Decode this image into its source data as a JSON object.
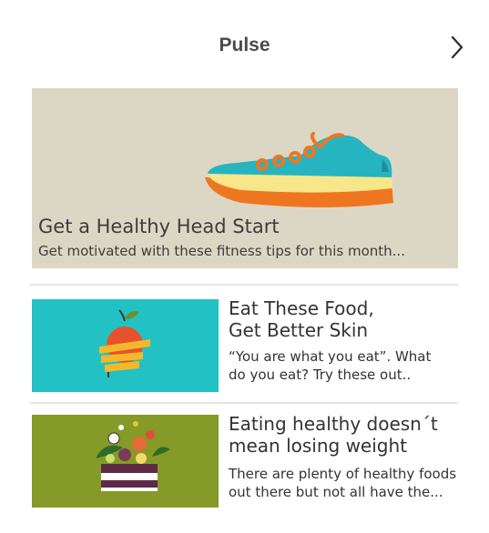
{
  "header": {
    "title": "Pulse",
    "next_icon": "chevron-right-icon"
  },
  "hero": {
    "title": "Get a Healthy Head Start",
    "subtitle": "Get motivated with these fitness tips for this month...",
    "image_icon": "sneaker-illustration",
    "bg_color": "#dcd7c5"
  },
  "articles": [
    {
      "title_line1": "Eat These Food,",
      "title_line2": "Get Better Skin",
      "text_line1": "“You are what you eat”. What",
      "text_line2": "do you eat? Try these out..",
      "image_icon": "apple-measuring-tape-illustration",
      "bg_color": "#22c2c4"
    },
    {
      "title_line1": "Eating healthy doesn´t",
      "title_line2": "mean losing weight",
      "text_line1": "There are plenty of healthy foods",
      "text_line2": "out there but not all have the...",
      "image_icon": "salad-bowl-illustration",
      "bg_color": "#869a28"
    }
  ]
}
